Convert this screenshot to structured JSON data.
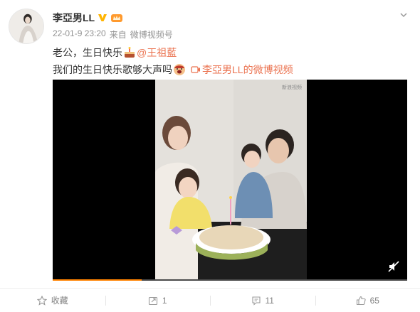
{
  "post": {
    "user_name": "李亞男LL",
    "timestamp": "22-01-9 23:20",
    "source_prefix": "来自",
    "source": "微博视频号",
    "line1_text": "老公，生日快乐",
    "mention": "@王祖藍",
    "line2_text": "我们的生日快乐歌够大声吗",
    "video_link_text": "李亞男LL的微博视频",
    "icons": {
      "verified": "verified-v-icon",
      "vip": "vip-crown-icon",
      "more": "chevron-down-icon",
      "cake": "cake-emoji-icon",
      "shout": "shout-emoji-icon",
      "video_link": "video-camera-icon",
      "mute": "mute-icon"
    }
  },
  "video": {
    "watermark": "新浪视频",
    "progress": 0.25
  },
  "actions": {
    "favorite": {
      "icon": "star-icon",
      "label": "收藏"
    },
    "repost": {
      "icon": "repost-icon",
      "label": "1"
    },
    "comment": {
      "icon": "comment-icon",
      "label": "11"
    },
    "like": {
      "icon": "thumbs-up-icon",
      "label": "65"
    }
  },
  "colors": {
    "link": "#eb7350",
    "accent": "#ff8200",
    "text": "#333333",
    "meta": "#939393"
  }
}
